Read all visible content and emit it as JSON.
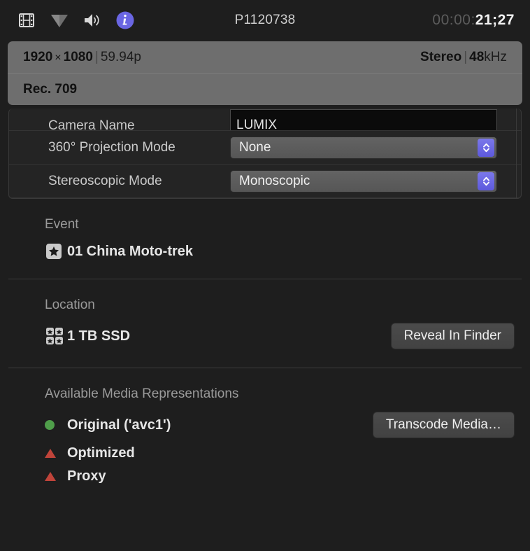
{
  "toolbar": {
    "icons": [
      {
        "name": "filmstrip-icon",
        "label": "Video"
      },
      {
        "name": "triangle-filter-icon",
        "label": "Filter"
      },
      {
        "name": "speaker-icon",
        "label": "Audio"
      },
      {
        "name": "info-icon",
        "label": "Info"
      }
    ],
    "title": "P1120738",
    "timecode_dim": "00:00:",
    "timecode_active": "21;27"
  },
  "banner": {
    "width": "1920",
    "multiply": "×",
    "height": "1080",
    "divider": "|",
    "framerate": "59.94p",
    "audio_channels": "Stereo",
    "audio_divider": "|",
    "sample_rate_value": "48",
    "sample_rate_unit": "kHz",
    "color_space": "Rec. 709"
  },
  "form": {
    "rows": [
      {
        "label": "Camera Name",
        "type": "text",
        "value": "LUMIX"
      },
      {
        "label": "360° Projection Mode",
        "type": "popup",
        "value": "None"
      },
      {
        "label": "Stereoscopic Mode",
        "type": "popup",
        "value": "Monoscopic"
      }
    ]
  },
  "event": {
    "title": "Event",
    "icon": "star-badge-icon",
    "name": "01 China Moto-trek"
  },
  "location": {
    "title": "Location",
    "icon": "library-grid-icon",
    "name": "1 TB SSD",
    "button": "Reveal In Finder"
  },
  "media": {
    "title": "Available Media Representations",
    "button": "Transcode Media…",
    "items": [
      {
        "label": "Original ('avc1')",
        "status": "available",
        "marker": "green-dot-icon"
      },
      {
        "label": "Optimized",
        "status": "unavailable",
        "marker": "red-triangle-icon"
      },
      {
        "label": "Proxy",
        "status": "unavailable",
        "marker": "red-triangle-icon"
      }
    ]
  },
  "colors": {
    "accent_blue": "#6a66e3",
    "banner_bg": "#6e6e6e",
    "available_green": "#4f9e4a",
    "unavailable_red": "#c0443a",
    "background": "#1e1e1e"
  }
}
